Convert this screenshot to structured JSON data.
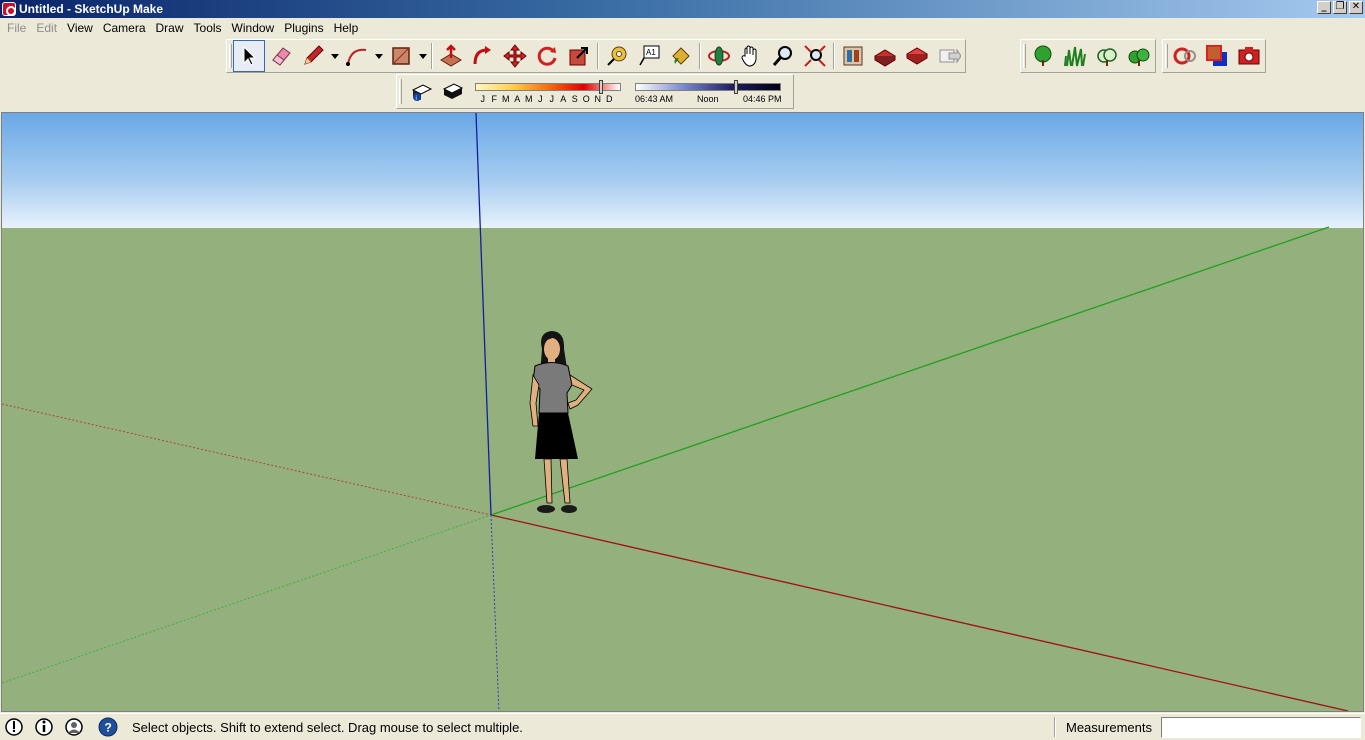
{
  "window": {
    "title": "Untitled - SketchUp Make",
    "minimize": "_",
    "restore": "❐",
    "close": "✕"
  },
  "menu": [
    {
      "label": "File",
      "disabled": true
    },
    {
      "label": "Edit",
      "disabled": true
    },
    {
      "label": "View",
      "disabled": false
    },
    {
      "label": "Camera",
      "disabled": false
    },
    {
      "label": "Draw",
      "disabled": false
    },
    {
      "label": "Tools",
      "disabled": false
    },
    {
      "label": "Window",
      "disabled": false
    },
    {
      "label": "Plugins",
      "disabled": false
    },
    {
      "label": "Help",
      "disabled": false
    }
  ],
  "toolbar": {
    "tools": [
      "select-icon",
      "eraser-icon",
      "pencil-icon",
      "arc-icon",
      "rectangle-icon",
      "push-pull-icon",
      "follow-me-icon",
      "move-icon",
      "rotate-icon",
      "scale-icon",
      "tape-measure-icon",
      "text-icon",
      "paint-bucket-icon",
      "orbit-icon",
      "pan-icon",
      "zoom-icon",
      "zoom-extents-icon",
      "warehouse-icon",
      "share-model-icon",
      "components-icon",
      "send-to-layout-icon",
      "tree-icon",
      "grass-icon",
      "shrub-icon",
      "bush-icon",
      "section-plane-icon",
      "materials-icon",
      "camera-icon"
    ]
  },
  "shadows": {
    "months": [
      "J",
      "F",
      "M",
      "A",
      "M",
      "J",
      "J",
      "A",
      "S",
      "O",
      "N",
      "D"
    ],
    "month_position": 0.85,
    "time_start": "06:43 AM",
    "time_mid": "Noon",
    "time_end": "04:46 PM",
    "time_position": 0.68
  },
  "colors": {
    "sky_top": "#6aa8e8",
    "ground": "#94b07c",
    "red_axis": "#a01010",
    "green_axis": "#20a020",
    "blue_axis": "#1020a0"
  },
  "status": {
    "hint": "Select objects. Shift to extend select. Drag mouse to select multiple.",
    "measurements_label": "Measurements",
    "measurements_value": ""
  }
}
